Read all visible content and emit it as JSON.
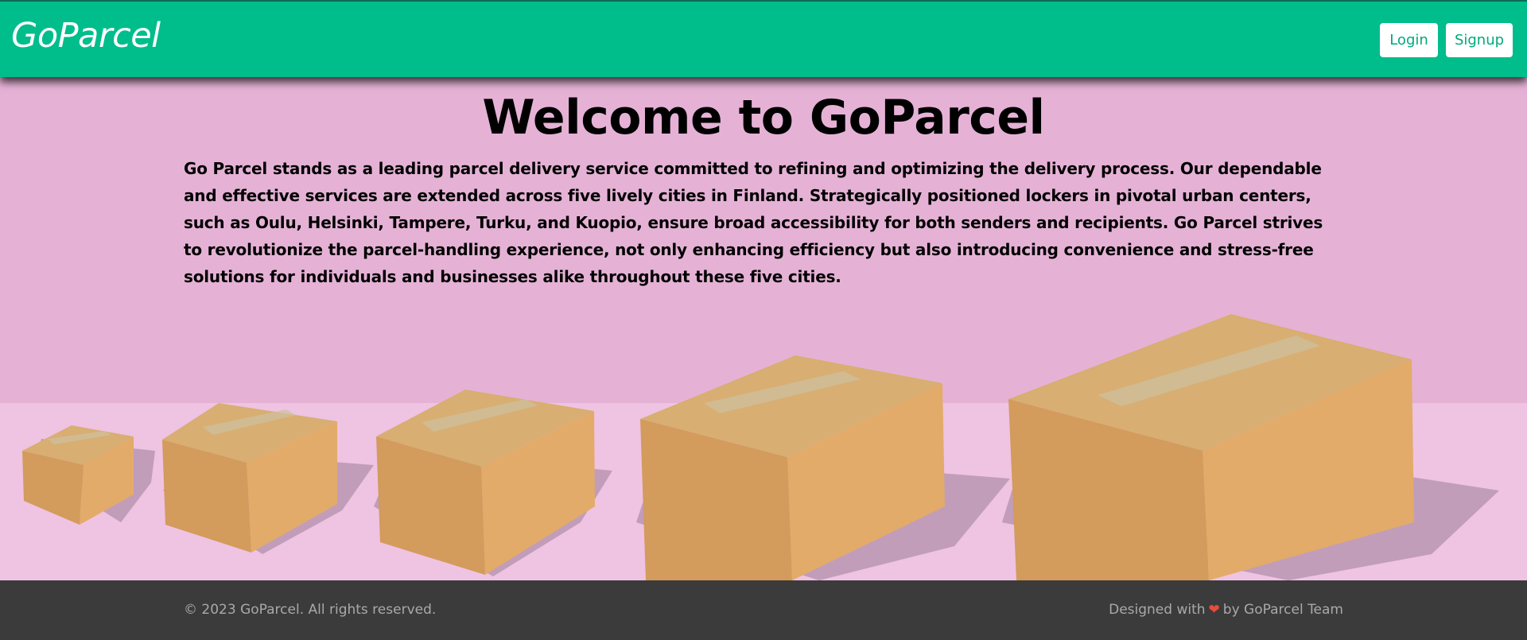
{
  "header": {
    "brand": "GoParcel",
    "login_label": "Login",
    "signup_label": "Signup"
  },
  "hero": {
    "title": "Welcome to GoParcel",
    "description": "Go Parcel stands as a leading parcel delivery service committed to refining and optimizing the delivery process. Our dependable and effective services are extended across five lively cities in Finland. Strategically positioned lockers in pivotal urban centers, such as Oulu, Helsinki, Tampere, Turku, and Kuopio, ensure broad accessibility for both senders and recipients. Go Parcel strives to revolutionize the parcel-handling experience, not only enhancing efficiency but also introducing convenience and stress-free solutions for individuals and businesses alike throughout these five cities."
  },
  "footer": {
    "copyright": "© 2023 GoParcel. All rights reserved.",
    "credits_prefix": "Designed with",
    "heart": "❤",
    "credits_suffix": "by GoParcel Team"
  },
  "colors": {
    "brand_green": "#00bd8c",
    "hero_background": "#e5b2d6",
    "footer_background": "#3b3b3b",
    "heart": "#e74c3c"
  }
}
